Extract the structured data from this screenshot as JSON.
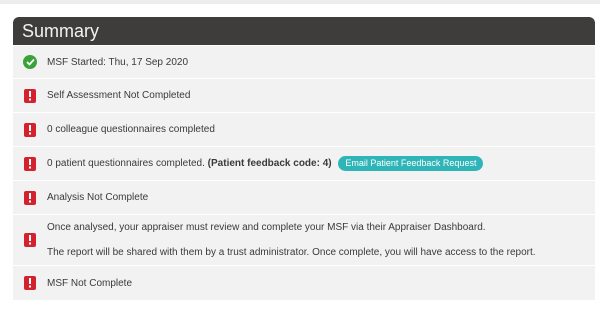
{
  "header": {
    "title": "Summary"
  },
  "colors": {
    "header_bg": "#3f3d3c",
    "row_bg": "#f2f2f2",
    "ok": "#3aa239",
    "error": "#d2222d",
    "accent": "#2fb5b8"
  },
  "rows": [
    {
      "icon": "check-icon",
      "text": "MSF Started: Thu, 17 Sep 2020"
    },
    {
      "icon": "exclamation-icon",
      "text": "Self Assessment Not Completed"
    },
    {
      "icon": "exclamation-icon",
      "text": "0 colleague questionnaires completed"
    },
    {
      "icon": "exclamation-icon",
      "text": "0 patient questionnaires completed.",
      "bold_text": "(Patient feedback code: 4)",
      "button_label": "Email Patient Feedback Request"
    },
    {
      "icon": "exclamation-icon",
      "text": "Analysis Not Complete"
    },
    {
      "icon": "exclamation-icon",
      "line1": "Once analysed, your appraiser must review and complete your MSF via their Appraiser Dashboard.",
      "line2": "The report will be shared with them by a trust administrator. Once complete, you will have access to the report."
    },
    {
      "icon": "exclamation-icon",
      "text": "MSF Not Complete"
    }
  ]
}
